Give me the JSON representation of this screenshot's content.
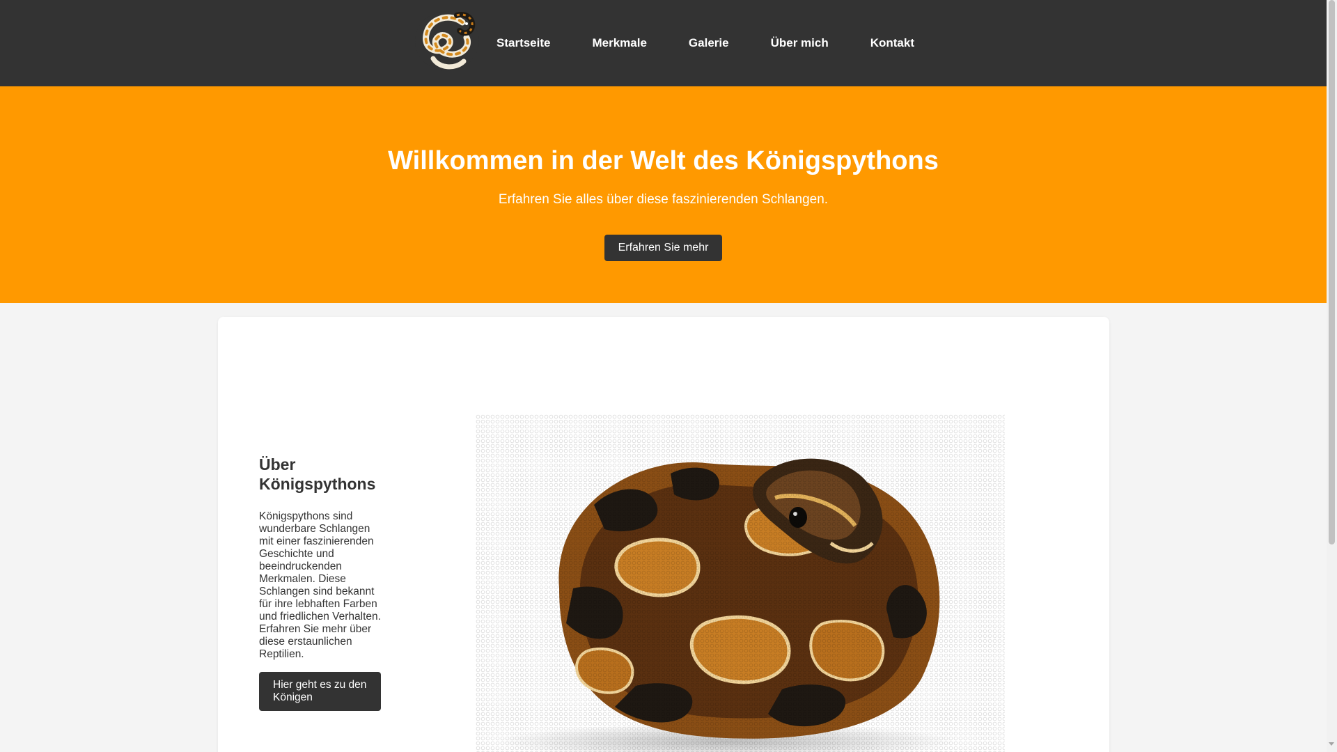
{
  "header": {
    "logo_name": "snake-logo-icon",
    "nav": [
      {
        "label": "Startseite"
      },
      {
        "label": "Merkmale"
      },
      {
        "label": "Galerie"
      },
      {
        "label": "Über mich"
      },
      {
        "label": "Kontakt"
      }
    ]
  },
  "hero": {
    "title": "Willkommen in der Welt des Königspythons",
    "subtitle": "Erfahren Sie alles über diese faszinierenden Schlangen.",
    "button_label": "Erfahren Sie mehr"
  },
  "about": {
    "heading": "Über Königspythons",
    "text": "Königspythons sind wunderbare Schlangen mit einer faszinierenden Geschichte und beeindruckenden Merkmalen. Diese Schlangen sind bekannt für ihre lebhaften Farben und friedlichen Verhalten. Erfahren Sie mehr über diese erstaunlichen Reptilien.",
    "button_label": "Hier geht es zu den Königen",
    "image_name": "ball-python-image"
  },
  "colors": {
    "header_bg": "#333333",
    "hero_bg": "#ff9900",
    "button_bg": "#333333",
    "page_bg": "#f4f4f4"
  }
}
